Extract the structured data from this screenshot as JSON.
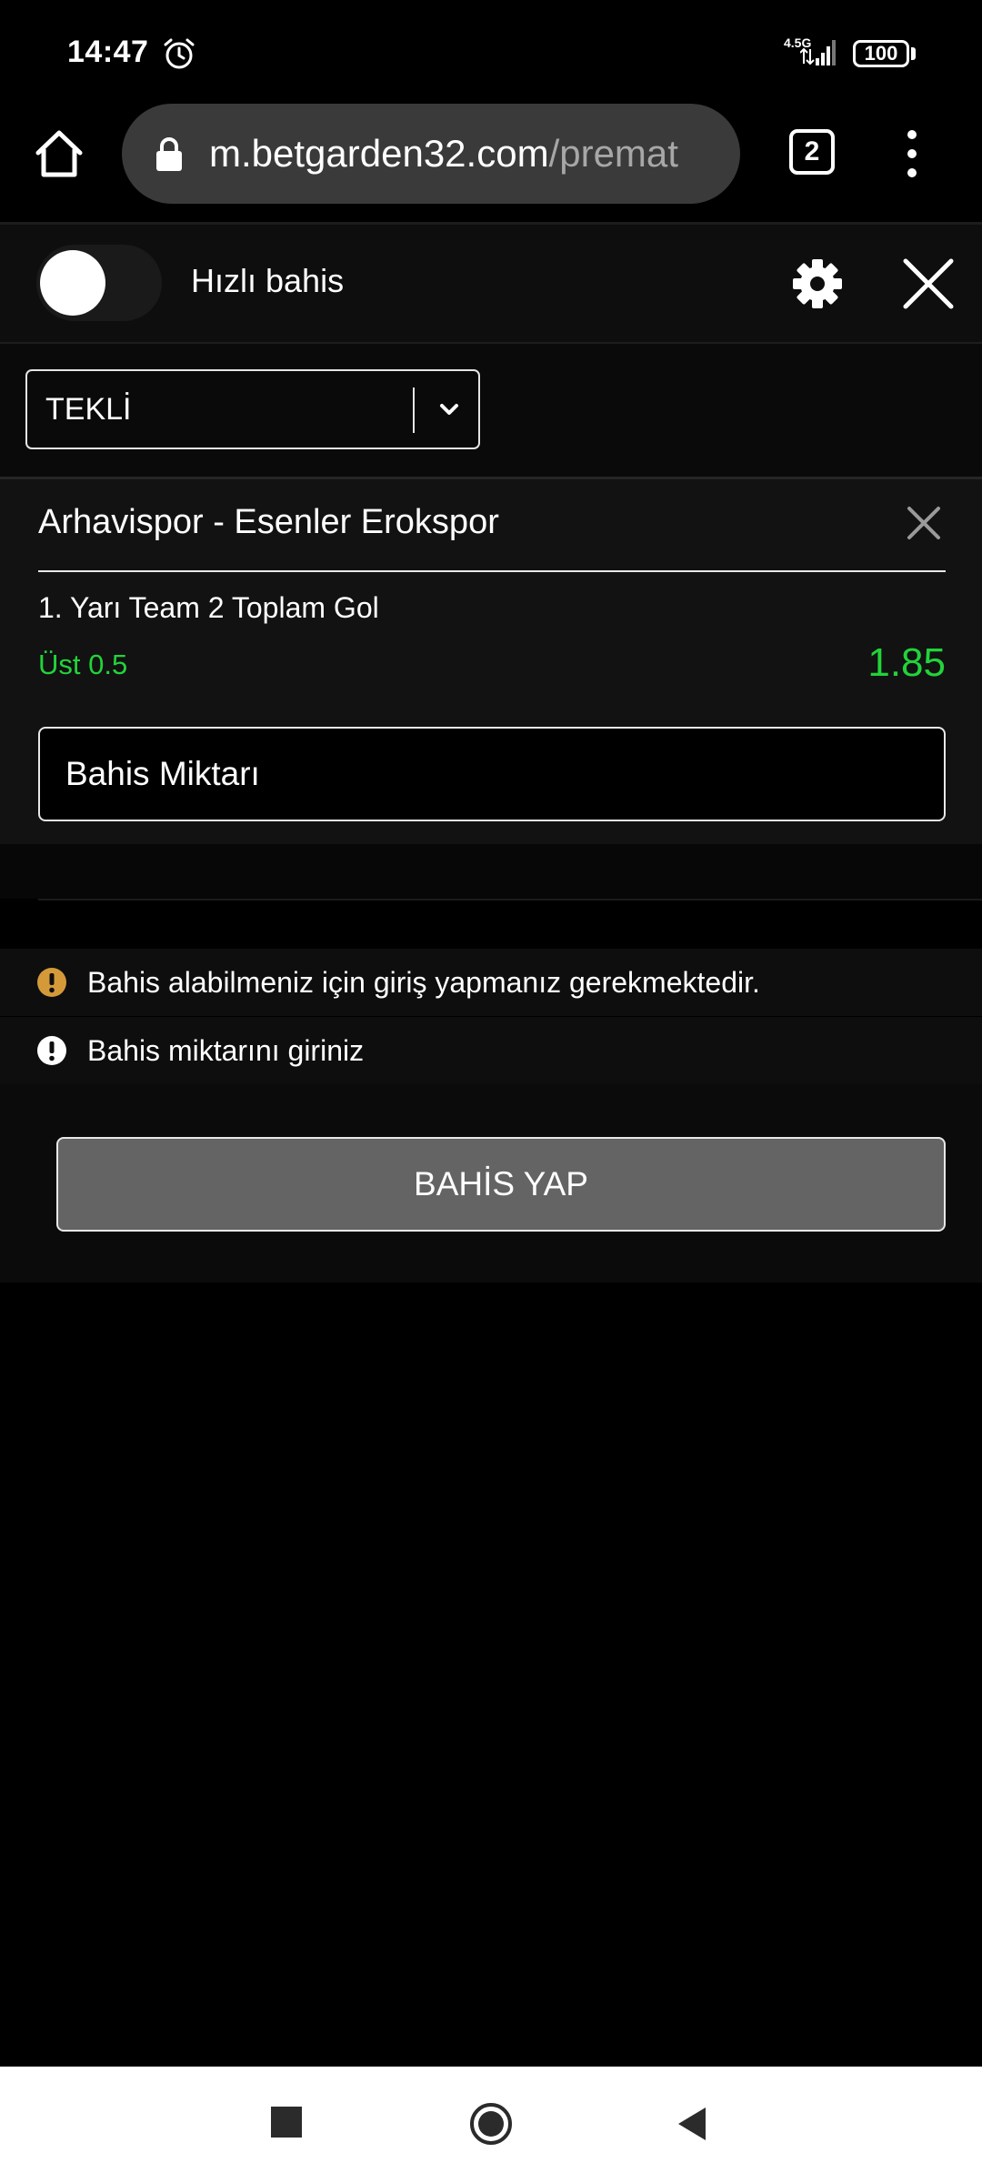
{
  "status_bar": {
    "time": "14:47",
    "network": "4.5G",
    "battery": "100",
    "icons": [
      "alarm-icon",
      "signal-icon",
      "battery-icon"
    ]
  },
  "browser": {
    "url_host": "m.betgarden32.com",
    "url_path": "/premat",
    "tab_count": "2",
    "icons": [
      "home-icon",
      "lock-icon",
      "tabs-icon",
      "more-vert-icon"
    ]
  },
  "slip_header": {
    "quick_bet_label": "Hızlı bahis",
    "quick_bet_on": false,
    "icons": [
      "gear-icon",
      "close-icon"
    ]
  },
  "bet_type": {
    "selected": "TEKLİ"
  },
  "bet": {
    "match": "Arhavispor - Esenler Erokspor",
    "market": "1. Yarı Team 2 Toplam Gol",
    "selection": "Üst 0.5",
    "odds": "1.85",
    "stake_placeholder": "Bahis Miktarı"
  },
  "messages": [
    {
      "text": "Bahis alabilmeniz için giriş yapmanız gerekmektedir.",
      "icon": "warning-icon",
      "color": "#d49a3a"
    },
    {
      "text": "Bahis miktarını giriniz",
      "icon": "alert-icon",
      "color": "#ffffff"
    }
  ],
  "actions": {
    "place_bet": "BAHİS YAP"
  },
  "colors": {
    "accent_green": "#22d33a",
    "button_gray": "#646464"
  }
}
